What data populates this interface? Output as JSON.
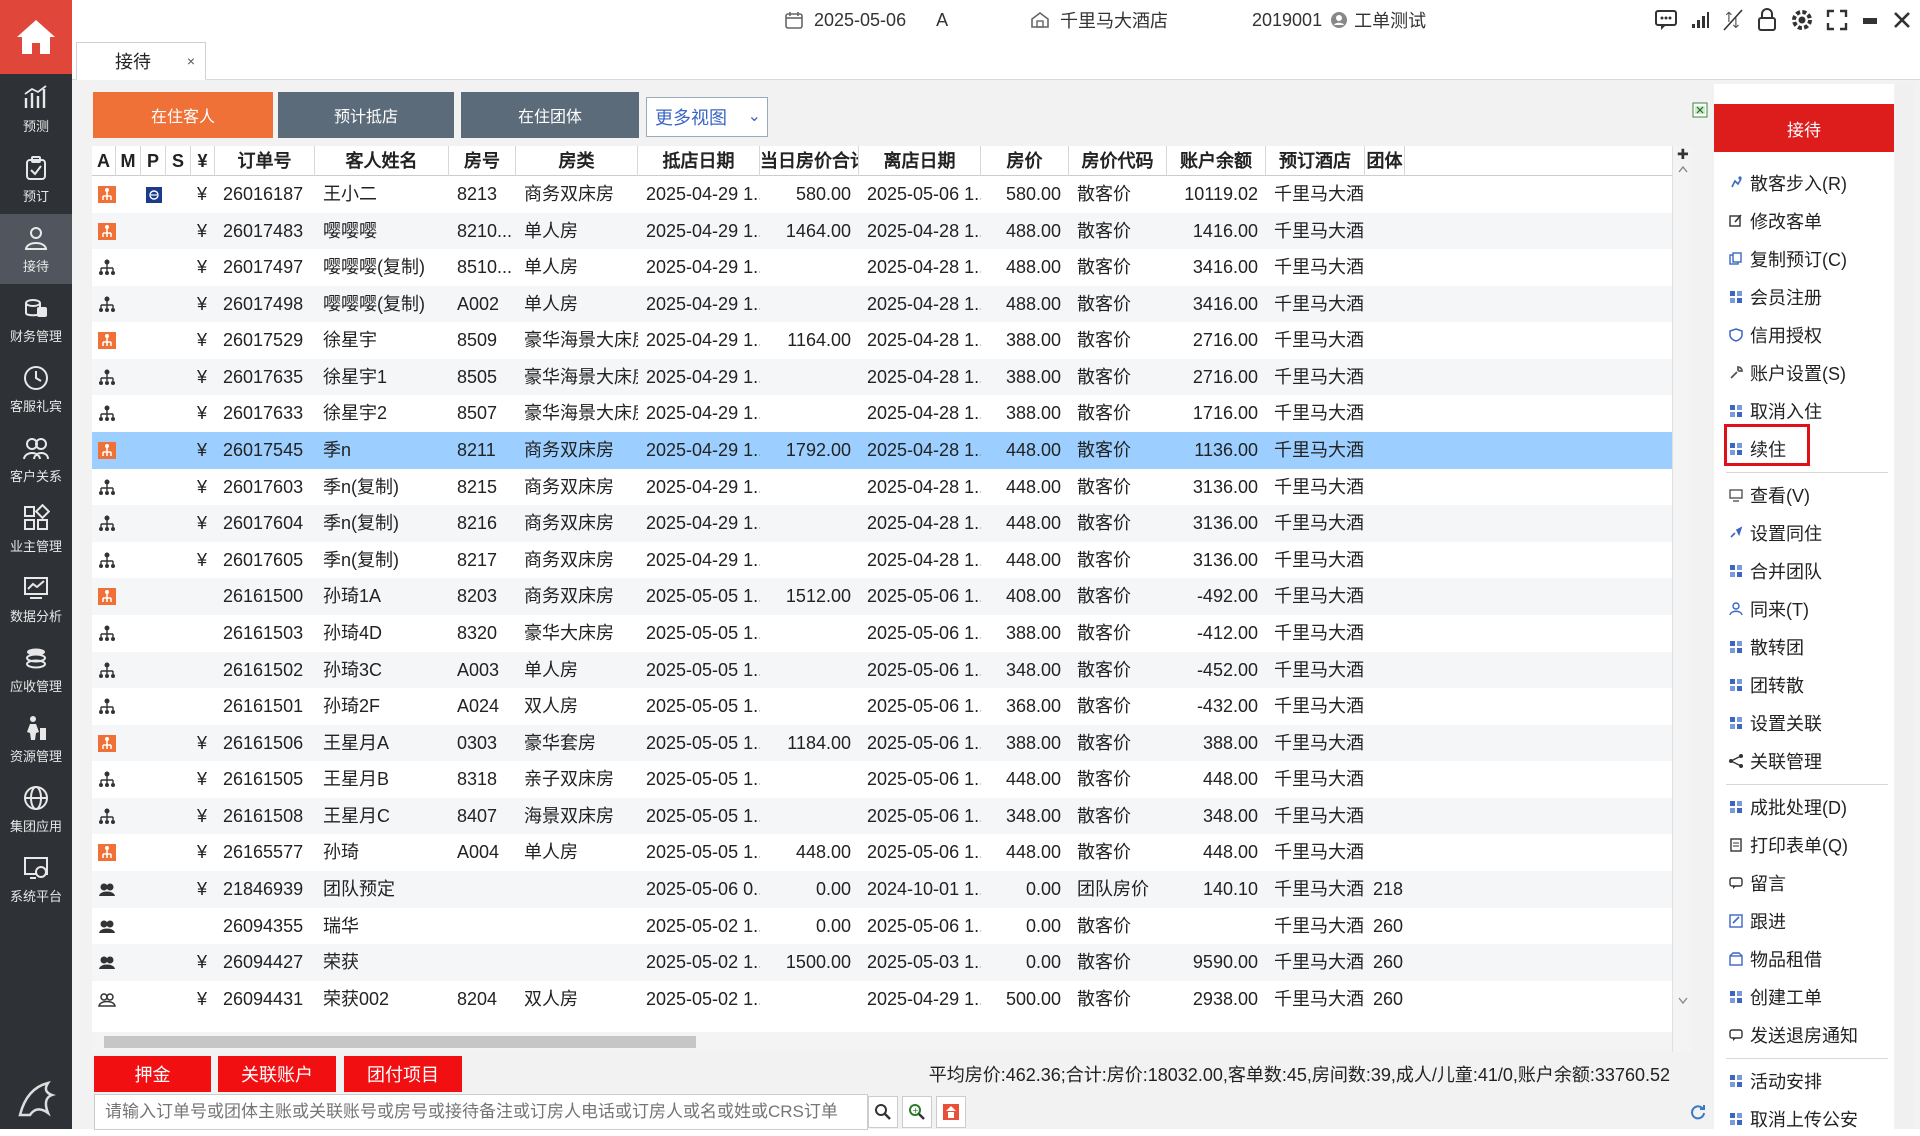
{
  "topbar": {
    "date": "2025-05-06",
    "shift": "A",
    "hotel": "千里马大酒店",
    "user_code": "2019001",
    "user_name": "工单测试"
  },
  "sidebar": [
    {
      "id": "forecast",
      "label": "预测"
    },
    {
      "id": "reserve",
      "label": "预订"
    },
    {
      "id": "reception",
      "label": "接待"
    },
    {
      "id": "finance",
      "label": "财务管理"
    },
    {
      "id": "guest-service",
      "label": "客服礼宾"
    },
    {
      "id": "crm",
      "label": "客户关系"
    },
    {
      "id": "owner",
      "label": "业主管理"
    },
    {
      "id": "analysis",
      "label": "数据分析"
    },
    {
      "id": "receivable",
      "label": "应收管理"
    },
    {
      "id": "resource",
      "label": "资源管理"
    },
    {
      "id": "group-app",
      "label": "集团应用"
    },
    {
      "id": "system",
      "label": "系统平台"
    }
  ],
  "tab": {
    "label": "接待",
    "close": "×"
  },
  "views": [
    {
      "label": "在住客人",
      "color": "#f07137"
    },
    {
      "label": "预计抵店",
      "color": "#5c6b7a"
    },
    {
      "label": "在住团体",
      "color": "#5c6b7a"
    }
  ],
  "more_view": "更多视图",
  "columns": [
    "A",
    "M",
    "P",
    "S",
    "¥",
    "订单号",
    "客人姓名",
    "房号",
    "房类",
    "抵店日期",
    "当日房价合计",
    "离店日期",
    "房价",
    "房价代码",
    "账户余额",
    "预订酒店",
    "团体"
  ],
  "rows": [
    {
      "icon": "box",
      "p": true,
      "yen": "¥",
      "order": "26016187",
      "name": "王小二",
      "room": "8213",
      "type": "商务双床房",
      "arr": "2025-04-29 1...",
      "today": "580.00",
      "dep": "2025-05-06 1...",
      "rate": "580.00",
      "code": "散客价",
      "bal": "10119.02",
      "hotel": "千里马大酒...",
      "grp": ""
    },
    {
      "icon": "box",
      "yen": "¥",
      "order": "26017483",
      "name": "嘤嘤嘤",
      "room": "8210...",
      "type": "单人房",
      "arr": "2025-04-29 1...",
      "today": "1464.00",
      "dep": "2025-04-28 1...",
      "rate": "488.00",
      "code": "散客价",
      "bal": "1416.00",
      "hotel": "千里马大酒...",
      "grp": ""
    },
    {
      "icon": "tree",
      "yen": "¥",
      "order": "26017497",
      "name": "嘤嘤嘤(复制)",
      "room": "8510...",
      "type": "单人房",
      "arr": "2025-04-29 1...",
      "today": "",
      "dep": "2025-04-28 1...",
      "rate": "488.00",
      "code": "散客价",
      "bal": "3416.00",
      "hotel": "千里马大酒...",
      "grp": ""
    },
    {
      "icon": "tree",
      "yen": "¥",
      "order": "26017498",
      "name": "嘤嘤嘤(复制)",
      "room": "A002",
      "type": "单人房",
      "arr": "2025-04-29 1...",
      "today": "",
      "dep": "2025-04-28 1...",
      "rate": "488.00",
      "code": "散客价",
      "bal": "3416.00",
      "hotel": "千里马大酒...",
      "grp": ""
    },
    {
      "icon": "box",
      "yen": "¥",
      "order": "26017529",
      "name": "徐星宇",
      "room": "8509",
      "type": "豪华海景大床房",
      "arr": "2025-04-29 1...",
      "today": "1164.00",
      "dep": "2025-04-28 1...",
      "rate": "388.00",
      "code": "散客价",
      "bal": "2716.00",
      "hotel": "千里马大酒...",
      "grp": ""
    },
    {
      "icon": "tree",
      "yen": "¥",
      "order": "26017635",
      "name": "徐星宇1",
      "room": "8505",
      "type": "豪华海景大床房",
      "arr": "2025-04-29 1...",
      "today": "",
      "dep": "2025-04-28 1...",
      "rate": "388.00",
      "code": "散客价",
      "bal": "2716.00",
      "hotel": "千里马大酒...",
      "grp": ""
    },
    {
      "icon": "tree",
      "yen": "¥",
      "order": "26017633",
      "name": "徐星宇2",
      "room": "8507",
      "type": "豪华海景大床房",
      "arr": "2025-04-29 1...",
      "today": "",
      "dep": "2025-04-28 1...",
      "rate": "388.00",
      "code": "散客价",
      "bal": "1716.00",
      "hotel": "千里马大酒...",
      "grp": ""
    },
    {
      "icon": "box",
      "sel": true,
      "yen": "¥",
      "order": "26017545",
      "name": "季n",
      "room": "8211",
      "type": "商务双床房",
      "arr": "2025-04-29 1...",
      "today": "1792.00",
      "dep": "2025-04-28 1...",
      "rate": "448.00",
      "code": "散客价",
      "bal": "1136.00",
      "hotel": "千里马大酒...",
      "grp": ""
    },
    {
      "icon": "tree",
      "yen": "¥",
      "order": "26017603",
      "name": "季n(复制)",
      "room": "8215",
      "type": "商务双床房",
      "arr": "2025-04-29 1...",
      "today": "",
      "dep": "2025-04-28 1...",
      "rate": "448.00",
      "code": "散客价",
      "bal": "3136.00",
      "hotel": "千里马大酒...",
      "grp": ""
    },
    {
      "icon": "tree",
      "yen": "¥",
      "order": "26017604",
      "name": "季n(复制)",
      "room": "8216",
      "type": "商务双床房",
      "arr": "2025-04-29 1...",
      "today": "",
      "dep": "2025-04-28 1...",
      "rate": "448.00",
      "code": "散客价",
      "bal": "3136.00",
      "hotel": "千里马大酒...",
      "grp": ""
    },
    {
      "icon": "tree",
      "yen": "¥",
      "order": "26017605",
      "name": "季n(复制)",
      "room": "8217",
      "type": "商务双床房",
      "arr": "2025-04-29 1...",
      "today": "",
      "dep": "2025-04-28 1...",
      "rate": "448.00",
      "code": "散客价",
      "bal": "3136.00",
      "hotel": "千里马大酒...",
      "grp": ""
    },
    {
      "icon": "box",
      "yen": "",
      "order": "26161500",
      "name": "孙琦1A",
      "room": "8203",
      "type": "商务双床房",
      "arr": "2025-05-05 1...",
      "today": "1512.00",
      "dep": "2025-05-06 1...",
      "rate": "408.00",
      "code": "散客价",
      "bal": "-492.00",
      "hotel": "千里马大酒...",
      "grp": ""
    },
    {
      "icon": "tree",
      "yen": "",
      "order": "26161503",
      "name": "孙琦4D",
      "room": "8320",
      "type": "豪华大床房",
      "arr": "2025-05-05 1...",
      "today": "",
      "dep": "2025-05-06 1...",
      "rate": "388.00",
      "code": "散客价",
      "bal": "-412.00",
      "hotel": "千里马大酒...",
      "grp": ""
    },
    {
      "icon": "tree",
      "yen": "",
      "order": "26161502",
      "name": "孙琦3C",
      "room": "A003",
      "type": "单人房",
      "arr": "2025-05-05 1...",
      "today": "",
      "dep": "2025-05-06 1...",
      "rate": "348.00",
      "code": "散客价",
      "bal": "-452.00",
      "hotel": "千里马大酒...",
      "grp": ""
    },
    {
      "icon": "tree",
      "yen": "",
      "order": "26161501",
      "name": "孙琦2F",
      "room": "A024",
      "type": "双人房",
      "arr": "2025-05-05 1...",
      "today": "",
      "dep": "2025-05-06 1...",
      "rate": "368.00",
      "code": "散客价",
      "bal": "-432.00",
      "hotel": "千里马大酒...",
      "grp": ""
    },
    {
      "icon": "box",
      "yen": "¥",
      "order": "26161506",
      "name": "王星月A",
      "room": "0303",
      "type": "豪华套房",
      "arr": "2025-05-05 1...",
      "today": "1184.00",
      "dep": "2025-05-06 1...",
      "rate": "388.00",
      "code": "散客价",
      "bal": "388.00",
      "hotel": "千里马大酒...",
      "grp": ""
    },
    {
      "icon": "tree",
      "yen": "¥",
      "order": "26161505",
      "name": "王星月B",
      "room": "8318",
      "type": "亲子双床房",
      "arr": "2025-05-05 1...",
      "today": "",
      "dep": "2025-05-06 1...",
      "rate": "448.00",
      "code": "散客价",
      "bal": "448.00",
      "hotel": "千里马大酒...",
      "grp": ""
    },
    {
      "icon": "tree",
      "yen": "¥",
      "order": "26161508",
      "name": "王星月C",
      "room": "8407",
      "type": "海景双床房",
      "arr": "2025-05-05 1...",
      "today": "",
      "dep": "2025-05-06 1...",
      "rate": "348.00",
      "code": "散客价",
      "bal": "348.00",
      "hotel": "千里马大酒...",
      "grp": ""
    },
    {
      "icon": "box",
      "yen": "¥",
      "order": "26165577",
      "name": "孙琦",
      "room": "A004",
      "type": "单人房",
      "arr": "2025-05-05 1...",
      "today": "448.00",
      "dep": "2025-05-06 1...",
      "rate": "448.00",
      "code": "散客价",
      "bal": "448.00",
      "hotel": "千里马大酒...",
      "grp": ""
    },
    {
      "icon": "group",
      "yen": "¥",
      "order": "21846939",
      "name": "团队预定",
      "room": "",
      "type": "",
      "arr": "2025-05-06 0...",
      "today": "0.00",
      "dep": "2024-10-01 1...",
      "rate": "0.00",
      "code": "团队房价",
      "bal": "140.10",
      "hotel": "千里马大酒...",
      "grp": "218"
    },
    {
      "icon": "group",
      "yen": "",
      "order": "26094355",
      "name": "瑞华",
      "room": "",
      "type": "",
      "arr": "2025-05-02 1...",
      "today": "0.00",
      "dep": "2025-05-06 1...",
      "rate": "0.00",
      "code": "散客价",
      "bal": "",
      "hotel": "千里马大酒...",
      "grp": "260"
    },
    {
      "icon": "group",
      "yen": "¥",
      "order": "26094427",
      "name": "荣获",
      "room": "",
      "type": "",
      "arr": "2025-05-02 1...",
      "today": "1500.00",
      "dep": "2025-05-03 1...",
      "rate": "0.00",
      "code": "散客价",
      "bal": "9590.00",
      "hotel": "千里马大酒...",
      "grp": "260"
    },
    {
      "icon": "group2",
      "yen": "¥",
      "order": "26094431",
      "name": "荣获002",
      "room": "8204",
      "type": "双人房",
      "arr": "2025-05-02 1...",
      "today": "",
      "dep": "2025-04-29 1...",
      "rate": "500.00",
      "code": "散客价",
      "bal": "2938.00",
      "hotel": "千里马大酒...",
      "grp": "260"
    }
  ],
  "bottom_buttons": [
    "押金",
    "关联账户",
    "团付项目"
  ],
  "summary": "平均房价:462.36;合计:房价:18032.00,客单数:45,房间数:39,成人/儿童:41/0,账户余额:33760.52",
  "search_placeholder": "请输入订单号或团体主账或关联账号或房号或接待备注或订房人电话或订房人或名或姓或CRS订单",
  "panel": {
    "title": "接待",
    "items": [
      {
        "label": "散客步入(R)",
        "icon": "walk"
      },
      {
        "label": "修改客单",
        "icon": "edit"
      },
      {
        "label": "复制预订(C)",
        "icon": "copy"
      },
      {
        "label": "会员注册",
        "icon": "grid"
      },
      {
        "label": "信用授权",
        "icon": "shield"
      },
      {
        "label": "账户设置(S)",
        "icon": "wrench"
      },
      {
        "label": "取消入住",
        "icon": "grid"
      },
      {
        "label": "续住",
        "icon": "grid"
      },
      {
        "label": "查看(V)",
        "icon": "monitor"
      },
      {
        "label": "设置同住",
        "icon": "link"
      },
      {
        "label": "合并团队",
        "icon": "grid"
      },
      {
        "label": "同来(T)",
        "icon": "person"
      },
      {
        "label": "散转团",
        "icon": "grid"
      },
      {
        "label": "团转散",
        "icon": "grid"
      },
      {
        "label": "设置关联",
        "icon": "grid"
      },
      {
        "label": "关联管理",
        "icon": "share"
      },
      {
        "label": "成批处理(D)",
        "icon": "grid"
      },
      {
        "label": "打印表单(Q)",
        "icon": "doc"
      },
      {
        "label": "留言",
        "icon": "chat"
      },
      {
        "label": "跟进",
        "icon": "note"
      },
      {
        "label": "物品租借",
        "icon": "box2"
      },
      {
        "label": "创建工单",
        "icon": "grid"
      },
      {
        "label": "发送退房通知",
        "icon": "chat"
      },
      {
        "label": "活动安排",
        "icon": "grid"
      },
      {
        "label": "取消上传公安",
        "icon": "grid"
      }
    ]
  }
}
